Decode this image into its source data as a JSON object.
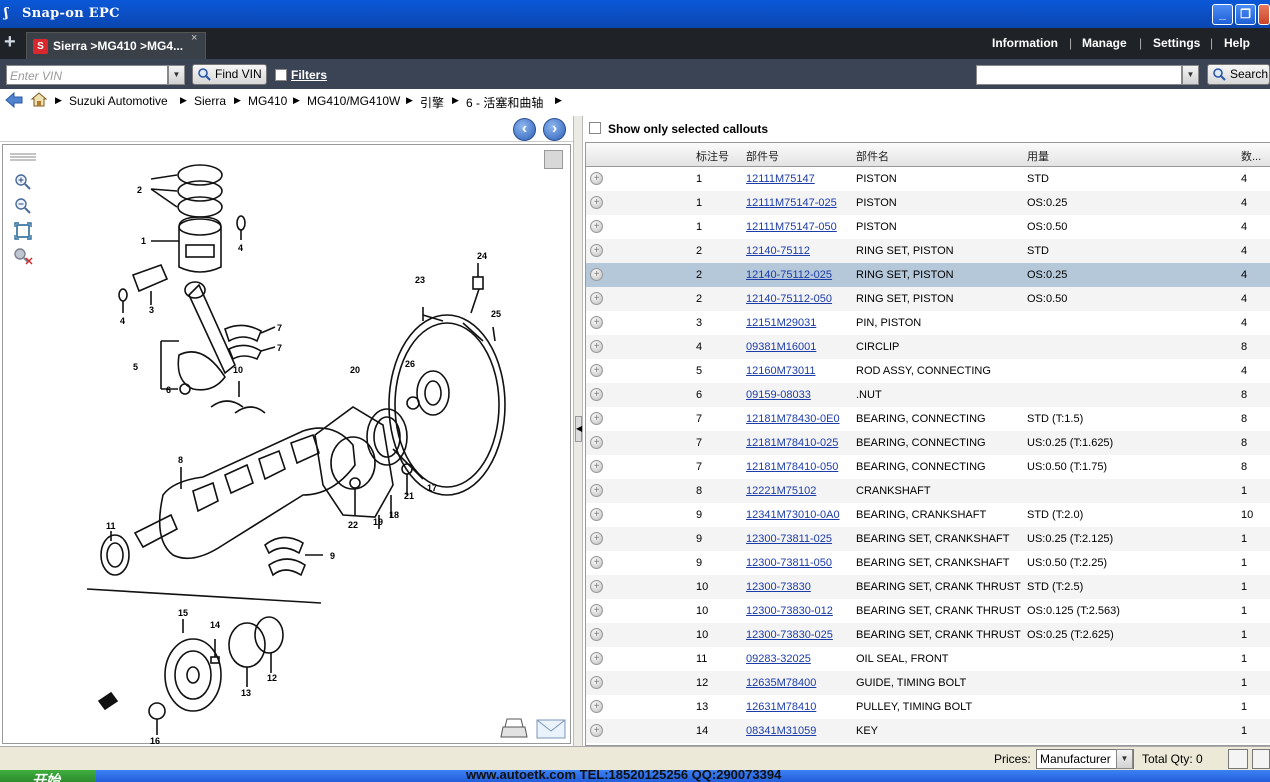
{
  "window": {
    "title": "Snap-on EPC",
    "minimize": "_",
    "maximize": "❐",
    "close": "✕"
  },
  "tabs": {
    "add": "+",
    "active": "Sierra >MG410 >MG4...",
    "close": "×"
  },
  "topmenu": [
    "Information",
    "Manage",
    "Settings",
    "Help"
  ],
  "toolbar": {
    "vin_placeholder": "Enter VIN",
    "find_vin": "Find VIN",
    "filters": "Filters",
    "search_label": "Search",
    "search_value": ""
  },
  "breadcrumb": [
    "Suzuki Automotive",
    "Sierra",
    "MG410",
    "MG410/MG410W",
    "引擎",
    "6 - 活塞和曲轴"
  ],
  "parts_panel": {
    "show_selected_label": "Show only selected callouts",
    "columns": [
      "标注号",
      "部件号",
      "部件名",
      "用量",
      "数..."
    ],
    "rows": [
      {
        "callout": "1",
        "part": "12111M75147",
        "name": "PISTON",
        "usage": "STD",
        "qty": "4"
      },
      {
        "callout": "1",
        "part": "12111M75147-025",
        "name": "PISTON",
        "usage": "OS:0.25",
        "qty": "4"
      },
      {
        "callout": "1",
        "part": "12111M75147-050",
        "name": "PISTON",
        "usage": "OS:0.50",
        "qty": "4"
      },
      {
        "callout": "2",
        "part": "12140-75112",
        "name": "RING SET, PISTON",
        "usage": "STD",
        "qty": "4"
      },
      {
        "callout": "2",
        "part": "12140-75112-025",
        "name": "RING SET, PISTON",
        "usage": "OS:0.25",
        "qty": "4"
      },
      {
        "callout": "2",
        "part": "12140-75112-050",
        "name": "RING SET, PISTON",
        "usage": "OS:0.50",
        "qty": "4"
      },
      {
        "callout": "3",
        "part": "12151M29031",
        "name": "PIN, PISTON",
        "usage": "",
        "qty": "4"
      },
      {
        "callout": "4",
        "part": "09381M16001",
        "name": "CIRCLIP",
        "usage": "",
        "qty": "8"
      },
      {
        "callout": "5",
        "part": "12160M73011",
        "name": "ROD ASSY, CONNECTING",
        "usage": "",
        "qty": "4"
      },
      {
        "callout": "6",
        "part": "09159-08033",
        "name": ".NUT",
        "usage": "",
        "qty": "8"
      },
      {
        "callout": "7",
        "part": "12181M78430-0E0",
        "name": "BEARING, CONNECTING",
        "usage": "STD (T:1.5)",
        "qty": "8"
      },
      {
        "callout": "7",
        "part": "12181M78410-025",
        "name": "BEARING, CONNECTING",
        "usage": "US:0.25 (T:1.625)",
        "qty": "8"
      },
      {
        "callout": "7",
        "part": "12181M78410-050",
        "name": "BEARING, CONNECTING",
        "usage": "US:0.50 (T:1.75)",
        "qty": "8"
      },
      {
        "callout": "8",
        "part": "12221M75102",
        "name": "CRANKSHAFT",
        "usage": "",
        "qty": "1"
      },
      {
        "callout": "9",
        "part": "12341M73010-0A0",
        "name": "BEARING, CRANKSHAFT",
        "usage": "STD (T:2.0)",
        "qty": "10"
      },
      {
        "callout": "9",
        "part": "12300-73811-025",
        "name": "BEARING SET, CRANKSHAFT",
        "usage": "US:0.25 (T:2.125)",
        "qty": "1"
      },
      {
        "callout": "9",
        "part": "12300-73811-050",
        "name": "BEARING SET, CRANKSHAFT",
        "usage": "US:0.50 (T:2.25)",
        "qty": "1"
      },
      {
        "callout": "10",
        "part": "12300-73830",
        "name": "BEARING SET, CRANK THRUST",
        "usage": "STD (T:2.5)",
        "qty": "1"
      },
      {
        "callout": "10",
        "part": "12300-73830-012",
        "name": "BEARING SET, CRANK THRUST",
        "usage": "OS:0.125 (T:2.563)",
        "qty": "1"
      },
      {
        "callout": "10",
        "part": "12300-73830-025",
        "name": "BEARING SET, CRANK THRUST",
        "usage": "OS:0.25 (T:2.625)",
        "qty": "1"
      },
      {
        "callout": "11",
        "part": "09283-32025",
        "name": "OIL SEAL, FRONT",
        "usage": "",
        "qty": "1"
      },
      {
        "callout": "12",
        "part": "12635M78400",
        "name": "GUIDE, TIMING BOLT",
        "usage": "",
        "qty": "1"
      },
      {
        "callout": "13",
        "part": "12631M78410",
        "name": "PULLEY, TIMING BOLT",
        "usage": "",
        "qty": "1"
      },
      {
        "callout": "14",
        "part": "08341M31059",
        "name": "KEY",
        "usage": "",
        "qty": "1"
      }
    ],
    "selected_row": 4
  },
  "diagram": {
    "callouts": [
      "1",
      "2",
      "3",
      "4",
      "4",
      "5",
      "6",
      "7",
      "7",
      "8",
      "9",
      "10",
      "11",
      "12",
      "13",
      "14",
      "15",
      "16",
      "17",
      "18",
      "19",
      "20",
      "21",
      "22",
      "23",
      "24",
      "25",
      "26"
    ]
  },
  "footer": {
    "prices_label": "Prices:",
    "prices_value": "Manufacturer",
    "total_qty": "Total Qty: 0"
  },
  "taskbar": {
    "start": "开始",
    "watermark": "www.autoetk.com TEL:18520125256 QQ:290073394"
  },
  "colors": {
    "titlebar": "#0b4fc4",
    "tabbar": "#1f2327",
    "toolbar": "#3b4454",
    "selected_row": "#b4c8da",
    "link": "#1c3ca8"
  }
}
